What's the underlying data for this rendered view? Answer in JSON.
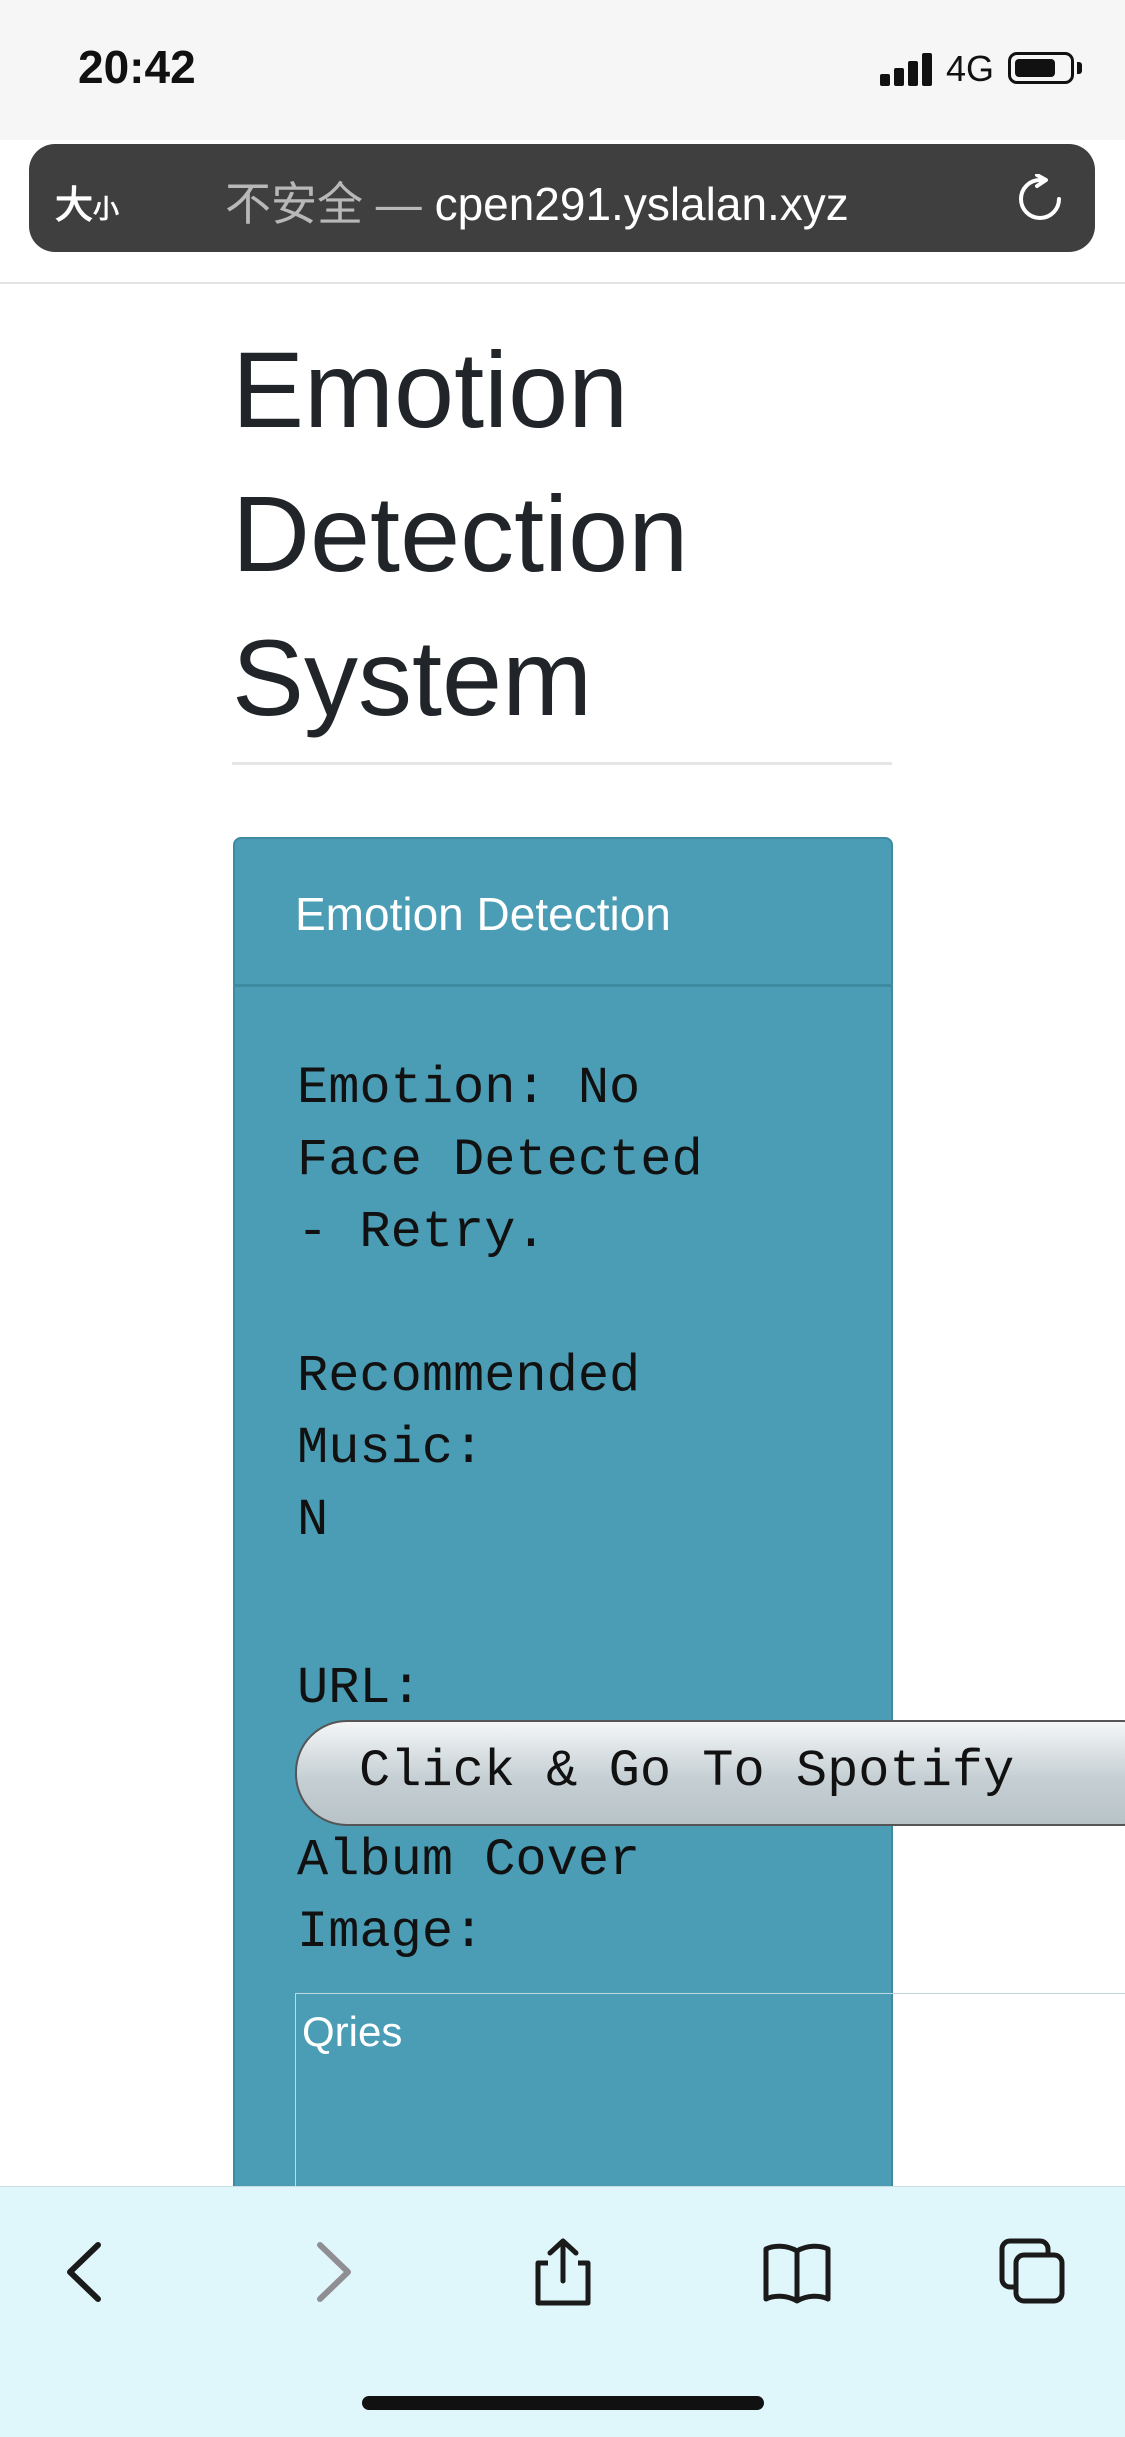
{
  "status_bar": {
    "time": "20:42",
    "network": "4G",
    "battery_percent": 70
  },
  "address_bar": {
    "text_size_big": "大",
    "text_size_small": "小",
    "security": "不安全 —",
    "domain": "cpen291.yslalan.xyz",
    "reload_icon": "reload-icon"
  },
  "page": {
    "title": "Emotion Detection System",
    "card": {
      "header": "Emotion Detection",
      "emotion_line": "Emotion: No\nFace Detected\n- Retry.",
      "recommended_label": "Recommended\nMusic:",
      "recommended_value": "N",
      "url_label": "URL:",
      "spotify_button": "Click & Go To Spotify",
      "album_label": "Album Cover\nImage:",
      "album_alt": "Qries"
    }
  },
  "toolbar": {
    "icons": [
      "back-icon",
      "forward-icon",
      "share-icon",
      "bookmarks-icon",
      "tabs-icon"
    ],
    "accent": "#1a1a1a",
    "disabled": "#8e8e93"
  }
}
